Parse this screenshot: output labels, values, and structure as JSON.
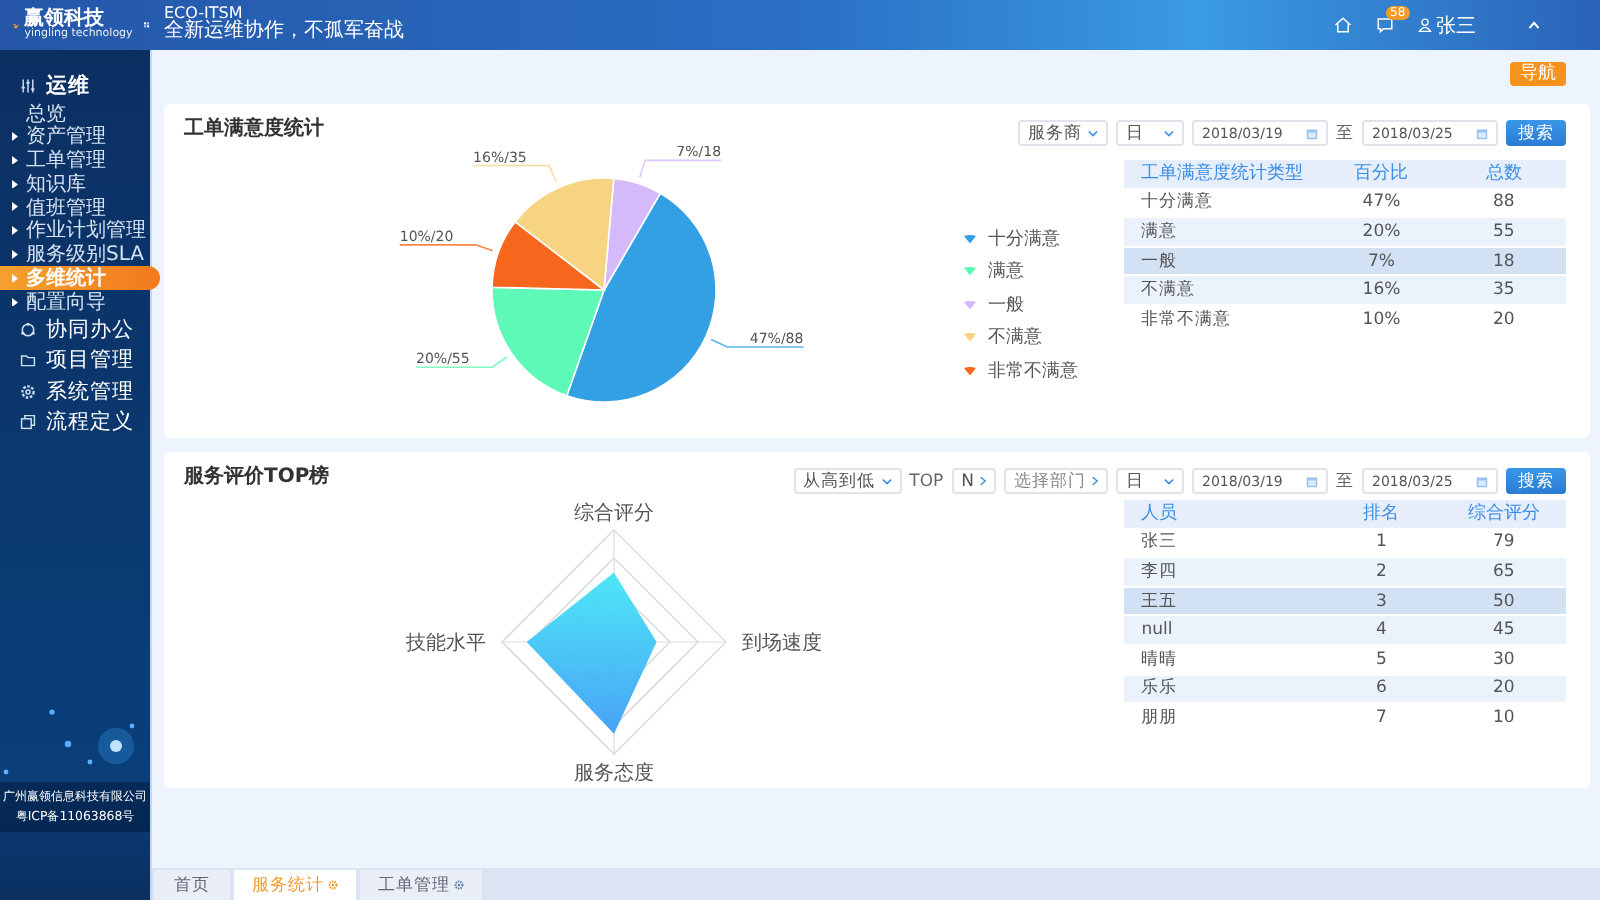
{
  "header": {
    "logo_text": "赢领科技",
    "logo_subtitle": "yingling technology",
    "app_title": "ECO-ITSM",
    "slogan": "全新运维协作，不孤军奋战",
    "message_badge": "58",
    "user_name": "张三"
  },
  "sidebar": {
    "sections": [
      {
        "label": "运维",
        "expanded": true,
        "children": [
          {
            "label": "总览",
            "kind": "link",
            "selected": false
          },
          {
            "label": "资产管理",
            "kind": "group",
            "selected": false
          },
          {
            "label": "工单管理",
            "kind": "group",
            "selected": false
          },
          {
            "label": "知识库",
            "kind": "group",
            "selected": false
          },
          {
            "label": "值班管理",
            "kind": "group",
            "selected": false
          },
          {
            "label": "作业计划管理",
            "kind": "group",
            "selected": false
          },
          {
            "label": "服务级别SLA",
            "kind": "group",
            "selected": false
          },
          {
            "label": "多维统计",
            "kind": "group",
            "selected": true
          },
          {
            "label": "配置向导",
            "kind": "group",
            "selected": false
          }
        ]
      },
      {
        "label": "协同办公",
        "expanded": false
      },
      {
        "label": "项目管理",
        "expanded": false
      },
      {
        "label": "系统管理",
        "expanded": false
      },
      {
        "label": "流程定义",
        "expanded": false
      }
    ],
    "footer": [
      "广州赢领信息科技有限公司",
      "粤ICP备11063868号"
    ]
  },
  "nav_button": "导航",
  "satisfaction": {
    "title": "工单满意度统计",
    "filters": [
      {
        "kind": "select",
        "value": "服务商"
      },
      {
        "kind": "select",
        "value": "日"
      },
      {
        "kind": "date",
        "value": "2018/03/19"
      },
      {
        "kind": "text",
        "value": "至"
      },
      {
        "kind": "date",
        "value": "2018/03/25"
      },
      {
        "kind": "button",
        "value": "搜索"
      }
    ],
    "chart_data": {
      "type": "pie",
      "categories": [
        "十分满意",
        "满意",
        "一般",
        "不满意",
        "非常不满意"
      ],
      "series": [
        {
          "values": [
            47,
            20,
            7,
            16,
            10
          ]
        }
      ],
      "value_labels": [
        "47%/88",
        "20%/55",
        "7%/18",
        "16%/35",
        "10%/20"
      ]
    },
    "legend": [
      {
        "color": "#33a0e3"
      },
      {
        "color": "#5ef9b6"
      },
      {
        "color": "#d4b9fb"
      },
      {
        "color": "#f7d481"
      },
      {
        "color": "#f6661c"
      }
    ],
    "table": {
      "columns": [
        "工单满意度统计类型",
        "百分比",
        "总数"
      ],
      "rows": [
        {
          "cells": [
            "十分满意",
            "47%",
            "88"
          ],
          "selected": false
        },
        {
          "cells": [
            "满意",
            "20%",
            "55"
          ],
          "selected": false
        },
        {
          "cells": [
            "一般",
            "7%",
            "18"
          ],
          "selected": true
        },
        {
          "cells": [
            "不满意",
            "16%",
            "35"
          ],
          "selected": false
        },
        {
          "cells": [
            "非常不满意",
            "10%",
            "20"
          ],
          "selected": false
        }
      ]
    }
  },
  "ranking": {
    "title": "服务评价TOP榜",
    "filters": [
      {
        "kind": "select",
        "value": "从高到低"
      },
      {
        "kind": "text",
        "value": "TOP"
      },
      {
        "kind": "stepper",
        "value": "N"
      },
      {
        "kind": "picker",
        "placeholder": "选择部门"
      },
      {
        "kind": "select",
        "value": "日"
      },
      {
        "kind": "date",
        "value": "2018/03/19"
      },
      {
        "kind": "text",
        "value": "至"
      },
      {
        "kind": "date",
        "value": "2018/03/25"
      },
      {
        "kind": "button",
        "value": "搜索"
      }
    ],
    "radar_axes": [
      "综合评分",
      "到场速度",
      "服务态度",
      "技能水平"
    ],
    "table": {
      "columns": [
        "人员",
        "排名",
        "综合评分"
      ],
      "rows": [
        {
          "cells": [
            "张三",
            "1",
            "79"
          ],
          "selected": false
        },
        {
          "cells": [
            "李四",
            "2",
            "65"
          ],
          "selected": false
        },
        {
          "cells": [
            "王五",
            "3",
            "50"
          ],
          "selected": true
        },
        {
          "cells": [
            "null",
            "4",
            "45"
          ],
          "selected": false
        },
        {
          "cells": [
            "晴晴",
            "5",
            "30"
          ],
          "selected": false
        },
        {
          "cells": [
            "乐乐",
            "6",
            "20"
          ],
          "selected": false
        },
        {
          "cells": [
            "朋朋",
            "7",
            "10"
          ],
          "selected": false
        }
      ]
    }
  },
  "tabs": [
    {
      "label": "首页",
      "selected": false,
      "has_settings": false
    },
    {
      "label": "服务统计",
      "selected": true,
      "has_settings": true
    },
    {
      "label": "工单管理",
      "selected": false,
      "has_settings": true
    }
  ]
}
